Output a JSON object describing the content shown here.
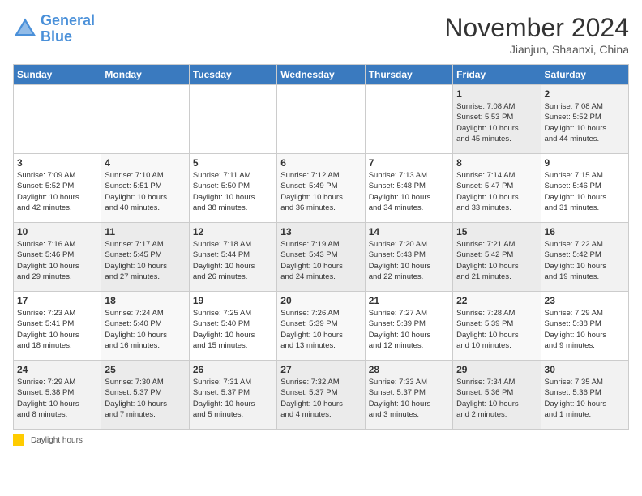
{
  "header": {
    "logo_line1": "General",
    "logo_line2": "Blue",
    "month": "November 2024",
    "location": "Jianjun, Shaanxi, China"
  },
  "days_of_week": [
    "Sunday",
    "Monday",
    "Tuesday",
    "Wednesday",
    "Thursday",
    "Friday",
    "Saturday"
  ],
  "footer": {
    "daylight_label": "Daylight hours"
  },
  "weeks": [
    [
      {
        "num": "",
        "info": ""
      },
      {
        "num": "",
        "info": ""
      },
      {
        "num": "",
        "info": ""
      },
      {
        "num": "",
        "info": ""
      },
      {
        "num": "",
        "info": ""
      },
      {
        "num": "1",
        "info": "Sunrise: 7:08 AM\nSunset: 5:53 PM\nDaylight: 10 hours\nand 45 minutes."
      },
      {
        "num": "2",
        "info": "Sunrise: 7:08 AM\nSunset: 5:52 PM\nDaylight: 10 hours\nand 44 minutes."
      }
    ],
    [
      {
        "num": "3",
        "info": "Sunrise: 7:09 AM\nSunset: 5:52 PM\nDaylight: 10 hours\nand 42 minutes."
      },
      {
        "num": "4",
        "info": "Sunrise: 7:10 AM\nSunset: 5:51 PM\nDaylight: 10 hours\nand 40 minutes."
      },
      {
        "num": "5",
        "info": "Sunrise: 7:11 AM\nSunset: 5:50 PM\nDaylight: 10 hours\nand 38 minutes."
      },
      {
        "num": "6",
        "info": "Sunrise: 7:12 AM\nSunset: 5:49 PM\nDaylight: 10 hours\nand 36 minutes."
      },
      {
        "num": "7",
        "info": "Sunrise: 7:13 AM\nSunset: 5:48 PM\nDaylight: 10 hours\nand 34 minutes."
      },
      {
        "num": "8",
        "info": "Sunrise: 7:14 AM\nSunset: 5:47 PM\nDaylight: 10 hours\nand 33 minutes."
      },
      {
        "num": "9",
        "info": "Sunrise: 7:15 AM\nSunset: 5:46 PM\nDaylight: 10 hours\nand 31 minutes."
      }
    ],
    [
      {
        "num": "10",
        "info": "Sunrise: 7:16 AM\nSunset: 5:46 PM\nDaylight: 10 hours\nand 29 minutes."
      },
      {
        "num": "11",
        "info": "Sunrise: 7:17 AM\nSunset: 5:45 PM\nDaylight: 10 hours\nand 27 minutes."
      },
      {
        "num": "12",
        "info": "Sunrise: 7:18 AM\nSunset: 5:44 PM\nDaylight: 10 hours\nand 26 minutes."
      },
      {
        "num": "13",
        "info": "Sunrise: 7:19 AM\nSunset: 5:43 PM\nDaylight: 10 hours\nand 24 minutes."
      },
      {
        "num": "14",
        "info": "Sunrise: 7:20 AM\nSunset: 5:43 PM\nDaylight: 10 hours\nand 22 minutes."
      },
      {
        "num": "15",
        "info": "Sunrise: 7:21 AM\nSunset: 5:42 PM\nDaylight: 10 hours\nand 21 minutes."
      },
      {
        "num": "16",
        "info": "Sunrise: 7:22 AM\nSunset: 5:42 PM\nDaylight: 10 hours\nand 19 minutes."
      }
    ],
    [
      {
        "num": "17",
        "info": "Sunrise: 7:23 AM\nSunset: 5:41 PM\nDaylight: 10 hours\nand 18 minutes."
      },
      {
        "num": "18",
        "info": "Sunrise: 7:24 AM\nSunset: 5:40 PM\nDaylight: 10 hours\nand 16 minutes."
      },
      {
        "num": "19",
        "info": "Sunrise: 7:25 AM\nSunset: 5:40 PM\nDaylight: 10 hours\nand 15 minutes."
      },
      {
        "num": "20",
        "info": "Sunrise: 7:26 AM\nSunset: 5:39 PM\nDaylight: 10 hours\nand 13 minutes."
      },
      {
        "num": "21",
        "info": "Sunrise: 7:27 AM\nSunset: 5:39 PM\nDaylight: 10 hours\nand 12 minutes."
      },
      {
        "num": "22",
        "info": "Sunrise: 7:28 AM\nSunset: 5:39 PM\nDaylight: 10 hours\nand 10 minutes."
      },
      {
        "num": "23",
        "info": "Sunrise: 7:29 AM\nSunset: 5:38 PM\nDaylight: 10 hours\nand 9 minutes."
      }
    ],
    [
      {
        "num": "24",
        "info": "Sunrise: 7:29 AM\nSunset: 5:38 PM\nDaylight: 10 hours\nand 8 minutes."
      },
      {
        "num": "25",
        "info": "Sunrise: 7:30 AM\nSunset: 5:37 PM\nDaylight: 10 hours\nand 7 minutes."
      },
      {
        "num": "26",
        "info": "Sunrise: 7:31 AM\nSunset: 5:37 PM\nDaylight: 10 hours\nand 5 minutes."
      },
      {
        "num": "27",
        "info": "Sunrise: 7:32 AM\nSunset: 5:37 PM\nDaylight: 10 hours\nand 4 minutes."
      },
      {
        "num": "28",
        "info": "Sunrise: 7:33 AM\nSunset: 5:37 PM\nDaylight: 10 hours\nand 3 minutes."
      },
      {
        "num": "29",
        "info": "Sunrise: 7:34 AM\nSunset: 5:36 PM\nDaylight: 10 hours\nand 2 minutes."
      },
      {
        "num": "30",
        "info": "Sunrise: 7:35 AM\nSunset: 5:36 PM\nDaylight: 10 hours\nand 1 minute."
      }
    ]
  ]
}
